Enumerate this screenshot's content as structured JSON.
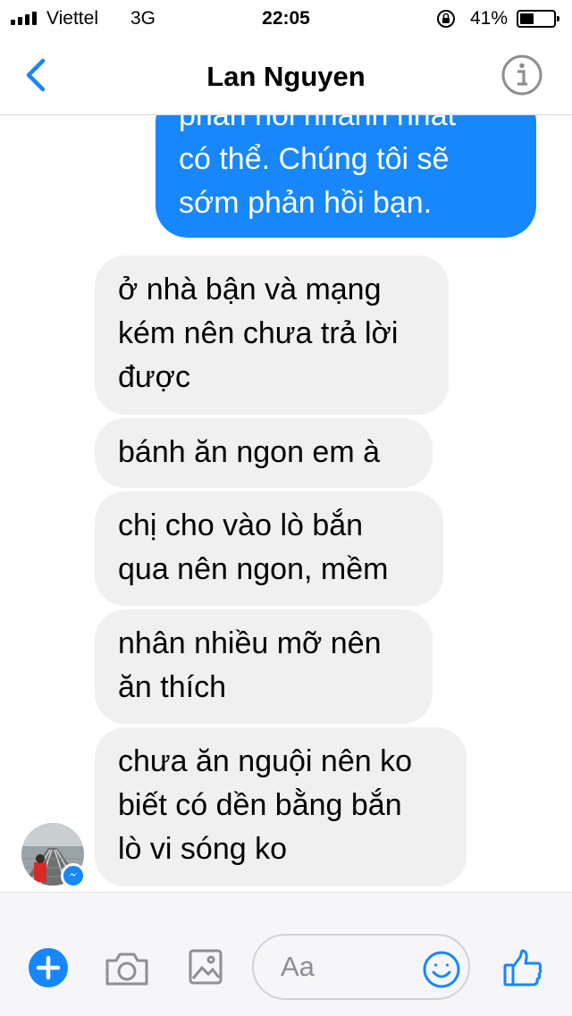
{
  "status_bar": {
    "carrier": "Viettel",
    "network": "3G",
    "time": "22:05",
    "battery_percent": "41%",
    "battery_level": 0.41,
    "signal_bars": 4
  },
  "header": {
    "back_icon": "chevron-left-icon",
    "title": "Lan Nguyen",
    "info_icon": "info-icon",
    "accent_color": "#1787fb"
  },
  "messages": {
    "outgoing": [
      {
        "lines": [
          "phản hồi nhanh nhất",
          "có thể. Chúng tôi sẽ",
          "sớm phản hồi bạn."
        ]
      }
    ],
    "incoming": [
      {
        "lines": [
          "ở nhà bận và mạng",
          "kém nên chưa trả lời",
          "được"
        ]
      },
      {
        "lines": [
          "bánh ăn ngon em à"
        ]
      },
      {
        "lines": [
          "chị cho vào lò bắn",
          "qua nên ngon, mềm"
        ]
      },
      {
        "lines": [
          "nhân nhiều mỡ nên",
          "ăn thích"
        ]
      },
      {
        "lines": [
          "chưa ăn nguội nên ko",
          "biết có dền bằng bắn",
          "lò vi sóng ko"
        ]
      }
    ],
    "outgoing_color": "#1787fb",
    "incoming_color": "#f0f0f0"
  },
  "composer": {
    "add_icon": "plus-icon",
    "camera_icon": "camera-icon",
    "gallery_icon": "image-icon",
    "placeholder": "Aa",
    "emoji_icon": "smiley-icon",
    "like_icon": "thumbs-up-icon"
  }
}
